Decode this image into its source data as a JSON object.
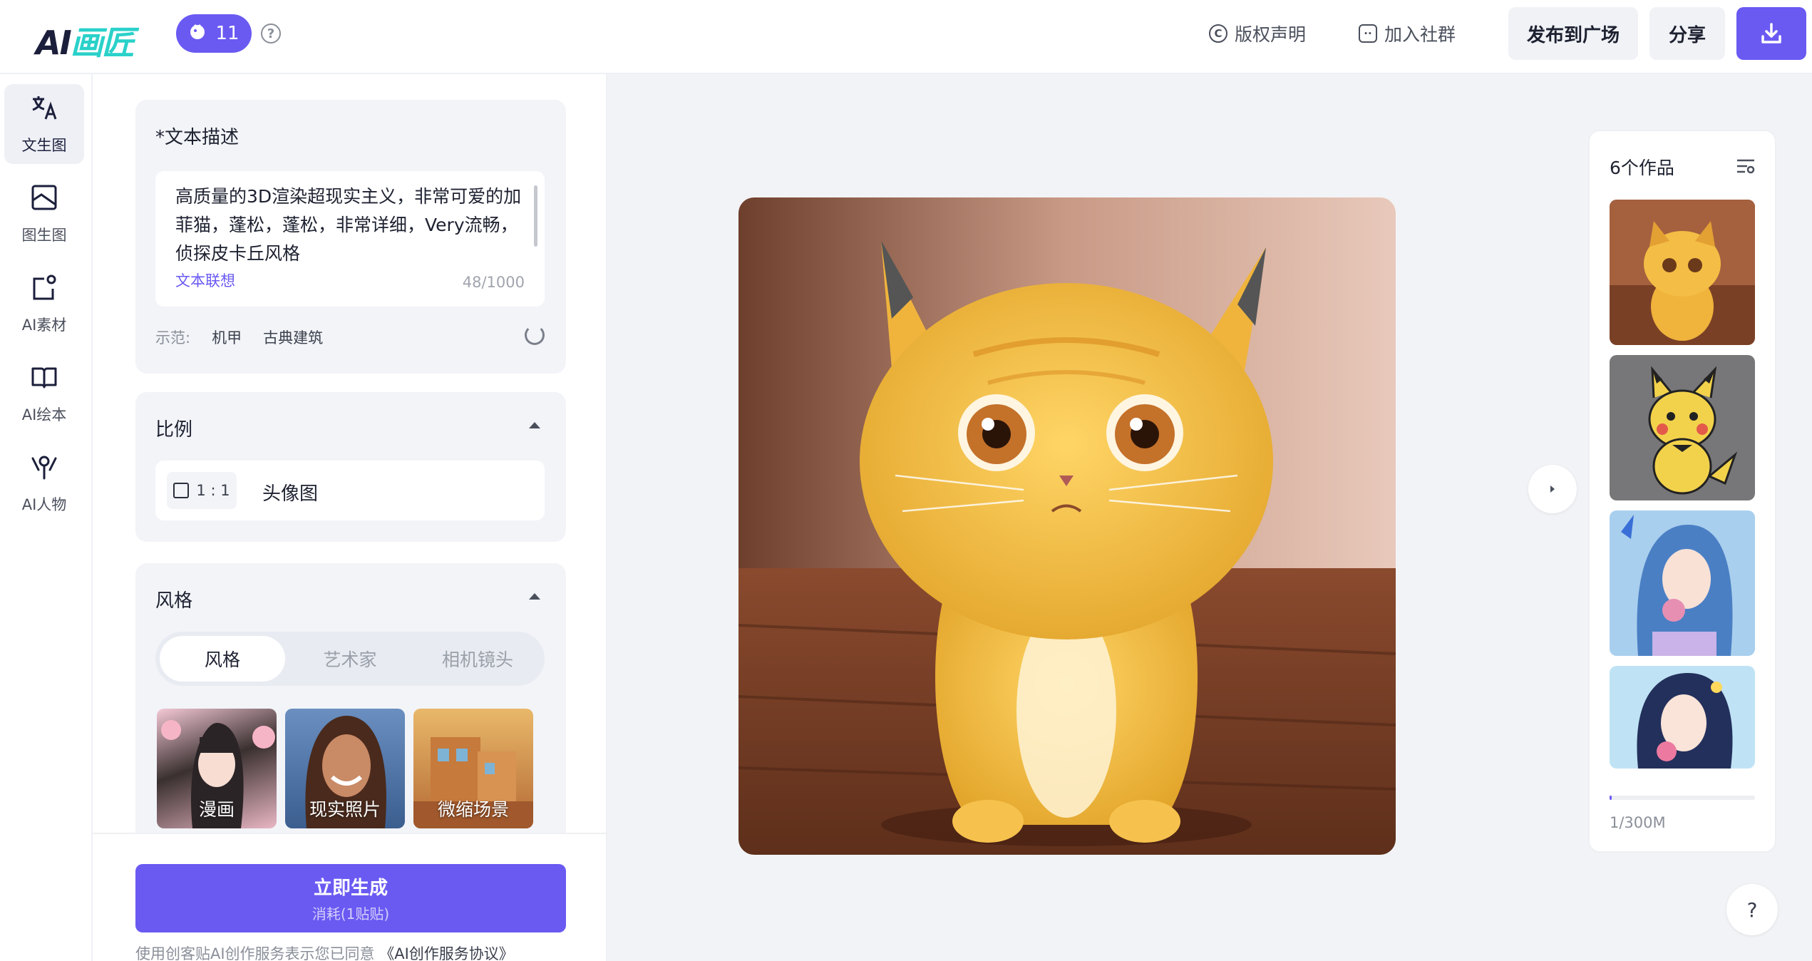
{
  "header": {
    "logo_main": "AI",
    "logo_accent": "画匠",
    "credits": "11",
    "copyright_label": "版权声明",
    "community_label": "加入社群",
    "publish_label": "发布到广场",
    "share_label": "分享"
  },
  "rail": {
    "items": [
      {
        "label": "文生图",
        "icon": "translate-icon"
      },
      {
        "label": "图生图",
        "icon": "image-to-image-icon"
      },
      {
        "label": "AI素材",
        "icon": "material-icon"
      },
      {
        "label": "AI绘本",
        "icon": "book-icon"
      },
      {
        "label": "AI人物",
        "icon": "person-icon"
      }
    ]
  },
  "prompt": {
    "title": "*文本描述",
    "text": "高质量的3D渲染超现实主义，非常可爱的加菲猫，蓬松，蓬松，非常详细，Very流畅，侦探皮卡丘风格",
    "association_label": "文本联想",
    "counter": "48/1000",
    "examples_label": "示范:",
    "examples": [
      "机甲",
      "古典建筑"
    ]
  },
  "ratio": {
    "title": "比例",
    "value": "1 : 1",
    "label": "头像图"
  },
  "style": {
    "title": "风格",
    "tabs": [
      "风格",
      "艺术家",
      "相机镜头"
    ],
    "options": [
      "漫画",
      "现实照片",
      "微缩场景"
    ]
  },
  "generate": {
    "label": "立即生成",
    "cost": "消耗(1贴贴)",
    "agreement_prefix": "使用创客贴AI创作服务表示您已同意",
    "agreement_link": "《AI创作服务协议》"
  },
  "gallery": {
    "title": "6个作品",
    "storage": "1/300M",
    "storage_fraction": 0.0033
  },
  "help_label": "?",
  "colors": {
    "accent": "#6a5af2",
    "canvas_bg": "#f2f3f6"
  }
}
